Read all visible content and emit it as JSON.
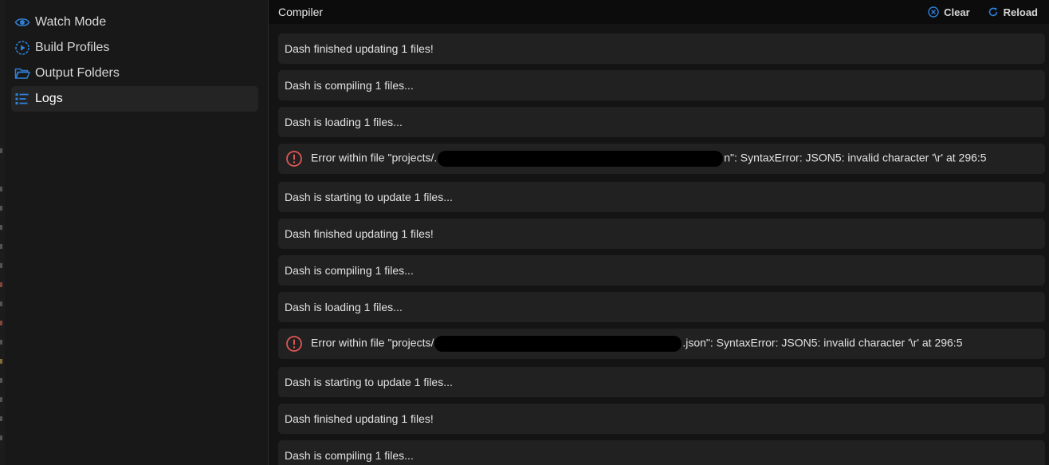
{
  "sidebar": {
    "items": [
      {
        "label": "Watch Mode",
        "icon": "eye-icon"
      },
      {
        "label": "Build Profiles",
        "icon": "play-circle-icon"
      },
      {
        "label": "Output Folders",
        "icon": "folder-open-icon"
      },
      {
        "label": "Logs",
        "icon": "list-icon",
        "active": true
      }
    ]
  },
  "header": {
    "title": "Compiler",
    "clear_label": "Clear",
    "reload_label": "Reload"
  },
  "logs": [
    {
      "type": "info",
      "text": "Dash finished updating 1 files!"
    },
    {
      "type": "info",
      "text": "Dash is compiling 1 files..."
    },
    {
      "type": "info",
      "text": "Dash is loading 1 files..."
    },
    {
      "type": "error",
      "prefix": "Error within file \"projects/.",
      "suffix": "n\": SyntaxError: JSON5: invalid character '\\r' at 296:5"
    },
    {
      "type": "info",
      "text": "Dash is starting to update 1 files..."
    },
    {
      "type": "info",
      "text": "Dash finished updating 1 files!"
    },
    {
      "type": "info",
      "text": "Dash is compiling 1 files..."
    },
    {
      "type": "info",
      "text": "Dash is loading 1 files..."
    },
    {
      "type": "error",
      "prefix": "Error within file \"projects/",
      "suffix": ".json\": SyntaxError: JSON5: invalid character '\\r' at 296:5"
    },
    {
      "type": "info",
      "text": "Dash is starting to update 1 files..."
    },
    {
      "type": "info",
      "text": "Dash finished updating 1 files!"
    },
    {
      "type": "info",
      "text": "Dash is compiling 1 files..."
    }
  ],
  "colors": {
    "accent": "#2f7fd6",
    "error": "#e05555"
  }
}
